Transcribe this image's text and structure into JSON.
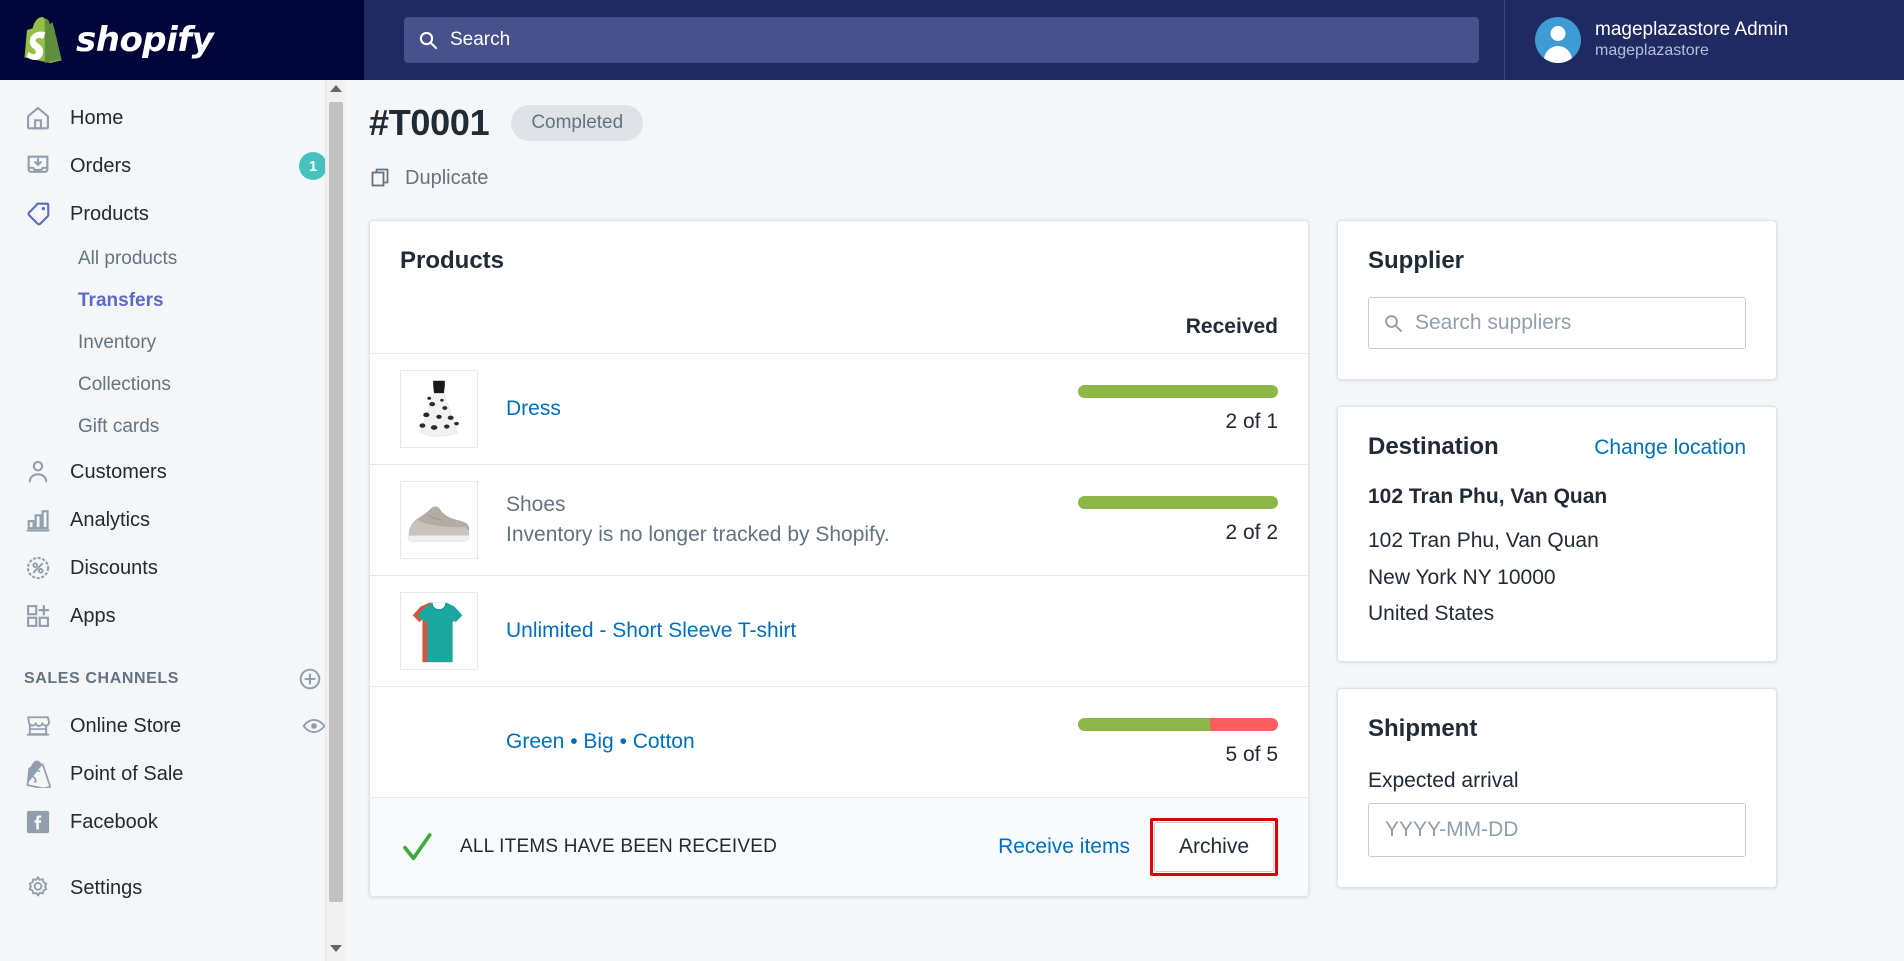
{
  "topbar": {
    "brand_name": "shopify",
    "search_placeholder": "Search",
    "user_name": "mageplazastore Admin",
    "user_store": "mageplazastore"
  },
  "sidebar": {
    "items": [
      {
        "label": "Home",
        "icon": "home-icon",
        "badge": ""
      },
      {
        "label": "Orders",
        "icon": "orders-icon",
        "badge": "1"
      },
      {
        "label": "Products",
        "icon": "products-tag-icon",
        "badge": ""
      },
      {
        "label": "Customers",
        "icon": "customer-icon",
        "badge": ""
      },
      {
        "label": "Analytics",
        "icon": "analytics-bars-icon",
        "badge": ""
      },
      {
        "label": "Discounts",
        "icon": "discount-percent-icon",
        "badge": ""
      },
      {
        "label": "Apps",
        "icon": "apps-grid-plus-icon",
        "badge": ""
      }
    ],
    "product_subitems": [
      {
        "label": "All products",
        "active": false
      },
      {
        "label": "Transfers",
        "active": true
      },
      {
        "label": "Inventory",
        "active": false
      },
      {
        "label": "Collections",
        "active": false
      },
      {
        "label": "Gift cards",
        "active": false
      }
    ],
    "sales_channels_heading": "SALES CHANNELS",
    "sales_channels": [
      {
        "label": "Online Store",
        "icon": "store-icon",
        "trailing_icon": "eye-icon"
      },
      {
        "label": "Point of Sale",
        "icon": "pos-bag-icon",
        "trailing_icon": ""
      },
      {
        "label": "Facebook",
        "icon": "facebook-icon",
        "trailing_icon": ""
      }
    ],
    "settings_label": "Settings"
  },
  "page": {
    "title": "#T0001",
    "status_badge": "Completed",
    "duplicate_label": "Duplicate"
  },
  "products_card": {
    "title": "Products",
    "received_header": "Received",
    "rows": [
      {
        "name": "Dress",
        "is_link": true,
        "note": "",
        "meta": "",
        "count": "2 of 1",
        "green_pct": 100,
        "red_pct": 0,
        "thumb": "dress-thumbnail"
      },
      {
        "name": "Shoes",
        "is_link": false,
        "note": "Inventory is no longer tracked by Shopify.",
        "meta": "",
        "count": "2 of 2",
        "green_pct": 100,
        "red_pct": 0,
        "thumb": "shoes-thumbnail"
      },
      {
        "name": "Unlimited - Short Sleeve T-shirt",
        "is_link": true,
        "note": "",
        "meta": "",
        "count": "",
        "green_pct": 0,
        "red_pct": 0,
        "thumb": "tshirt-thumbnail"
      },
      {
        "name": "",
        "is_link": true,
        "note": "",
        "meta": "Green • Big • Cotton",
        "count": "5 of 5",
        "green_pct": 66,
        "red_pct": 34,
        "thumb": ""
      }
    ],
    "footer_status": "ALL ITEMS HAVE BEEN RECEIVED",
    "receive_items_label": "Receive items",
    "archive_label": "Archive"
  },
  "supplier_card": {
    "title": "Supplier",
    "search_placeholder": "Search suppliers"
  },
  "destination_card": {
    "title": "Destination",
    "change_link": "Change location",
    "name": "102 Tran Phu, Van Quan",
    "address_lines": [
      "102 Tran Phu, Van Quan",
      "New York NY 10000",
      "United States"
    ]
  },
  "shipment_card": {
    "title": "Shipment",
    "arrival_label": "Expected arrival",
    "arrival_placeholder": "YYYY-MM-DD"
  },
  "colors": {
    "nav_dark": "#000639",
    "topbar": "#1f2a63",
    "accent_link": "#006fbb",
    "active_nav": "#5c6ac4",
    "progress_green": "#8db849",
    "progress_red": "#fb5e5e",
    "badge_teal": "#47c1bf",
    "highlight_red": "#e00000"
  }
}
